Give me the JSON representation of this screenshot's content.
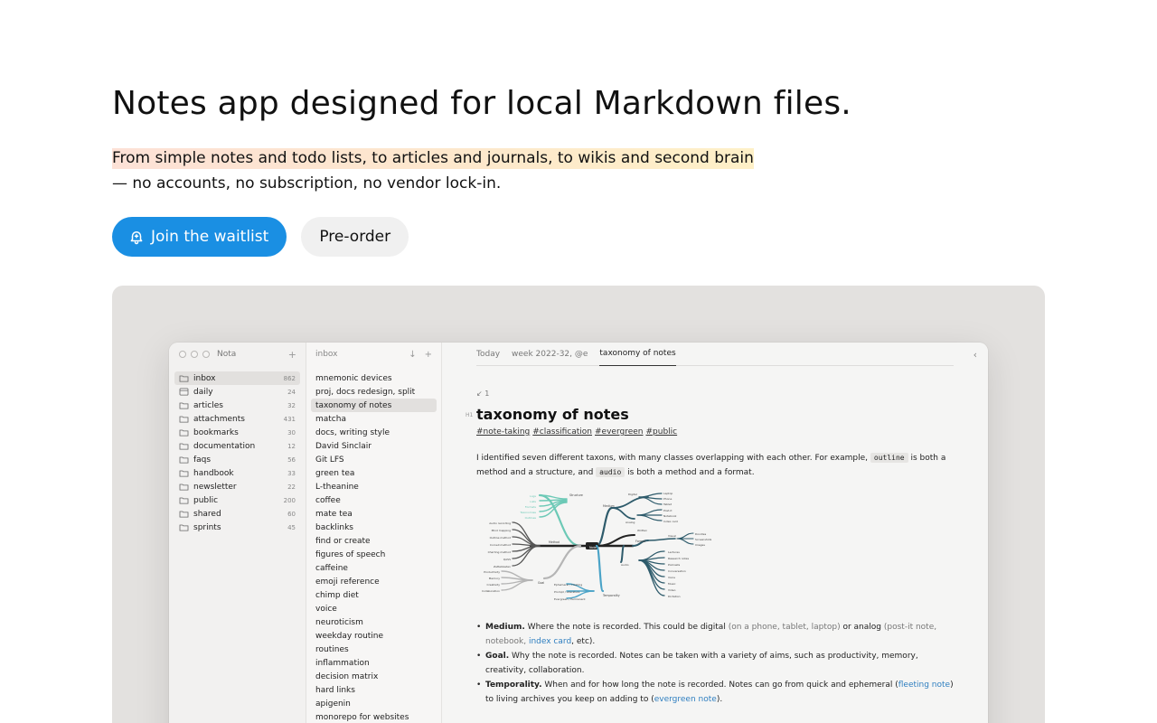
{
  "hero": {
    "title": "Notes app designed for local Markdown files.",
    "tagline_highlight": "From simple notes and todo lists, to articles and journals, to wikis and second brain",
    "tagline_rest": "— no accounts, no subscription, no vendor lock-in."
  },
  "cta": {
    "primary_label": "Join the waitlist",
    "secondary_label": "Pre-order"
  },
  "app": {
    "window_title": "Nota",
    "folders": [
      {
        "name": "inbox",
        "count": "862"
      },
      {
        "name": "daily",
        "count": "24"
      },
      {
        "name": "articles",
        "count": "32"
      },
      {
        "name": "attachments",
        "count": "431"
      },
      {
        "name": "bookmarks",
        "count": "30"
      },
      {
        "name": "documentation",
        "count": "12"
      },
      {
        "name": "faqs",
        "count": "56"
      },
      {
        "name": "handbook",
        "count": "33"
      },
      {
        "name": "newsletter",
        "count": "22"
      },
      {
        "name": "public",
        "count": "200"
      },
      {
        "name": "shared",
        "count": "60"
      },
      {
        "name": "sprints",
        "count": "45"
      }
    ],
    "list_title": "inbox",
    "notes": [
      "mnemonic devices",
      "proj, docs redesign, split",
      "taxonomy of notes",
      "matcha",
      "docs, writing style",
      "David Sinclair",
      "Git LFS",
      "green tea",
      "L-theanine",
      "coffee",
      "mate tea",
      "backlinks",
      "find or create",
      "figures of speech",
      "caffeine",
      "emoji reference",
      "chimp diet",
      "voice",
      "neuroticism",
      "weekday routine",
      "routines",
      "inflammation",
      "decision matrix",
      "hard links",
      "apigenin",
      "monorepo for websites"
    ],
    "tabs": [
      "Today",
      "week 2022-32, @e",
      "taxonomy of notes"
    ],
    "doc": {
      "backlinks": "↙ 1",
      "heading_marker": "H1",
      "title": "taxonomy of notes",
      "tags": [
        "#note-taking",
        "#classification",
        "#evergreen",
        "#public"
      ],
      "para_1": "I identified seven different taxons, with many classes overlapping with each other. For example,",
      "code_1": "outline",
      "para_2": "is both a method and a structure, and",
      "code_2": "audio",
      "para_3": "is both a method and a format.",
      "bullets": [
        {
          "term": "Medium.",
          "a": "Where the note is recorded. This could be digital",
          "b": "(on a phone, tablet, laptop)",
          "c": "or analog",
          "d": "(post-it note, notebook,",
          "link": "index card",
          "e": ", etc).",
          "f": ""
        },
        {
          "term": "Goal.",
          "a": "Why the note is recorded. Notes can be taken with a variety of aims, such as productivity, memory, creativity, collaboration.",
          "b": "",
          "c": "",
          "d": "",
          "link": "",
          "e": "",
          "f": ""
        },
        {
          "term": "Temporality.",
          "a": "When and for how long the note is recorded. Notes can go from quick and ephemeral (",
          "b": "",
          "c": "",
          "d": "",
          "link": "fleeting note",
          "e": ") to living archives you keep on adding to (",
          "f": "evergreen note"
        }
      ],
      "bullet_end": ")."
    },
    "diagram_labels": {
      "hub": "Note",
      "structure": "Structure",
      "medium": "Medium",
      "digital": "Digital",
      "analog": "Analog",
      "method": "Method",
      "format": "Format",
      "visual": "Visual",
      "audio": "Audio",
      "goal": "Goal",
      "temporality": "Temporality",
      "left": [
        "Audio recording",
        "Mind mapping",
        "Outline method",
        "Cornell method",
        "Charting method",
        "QASS",
        "Zettelkasten"
      ],
      "goal_items": [
        "Productivity",
        "Memory",
        "Creativity",
        "Collaboration"
      ],
      "temporal_items": [
        "Ephemeral / Fleeting",
        "Prompt / Literature",
        "Evergreen / Permanent"
      ],
      "structure_items": [
        "Logs",
        "Lists",
        "Formats",
        "Taxonomies",
        "Outlines"
      ],
      "digital_items": [
        "Laptop",
        "Phone",
        "Tablet"
      ],
      "analog_items": [
        "Post-it",
        "Notebook",
        "Index card"
      ],
      "visual_items": [
        "Doodles",
        "Screenshots",
        "Images"
      ],
      "audio_items": [
        "Lectures",
        "Research notes",
        "Podcasts",
        "Conversation",
        "Voice",
        "Music",
        "Video",
        "Dictation"
      ],
      "written": "Written"
    }
  },
  "colors": {
    "primary": "#1a8fe3",
    "link": "#2f7fc0"
  }
}
